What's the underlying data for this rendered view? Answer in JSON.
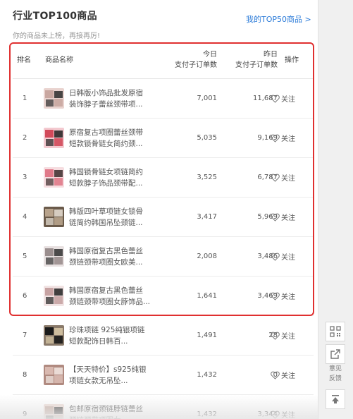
{
  "header": {
    "title": "行业TOP100商品",
    "top50_link": "我的TOP50商品 >",
    "subtitle": "你的商品未上榜，再接再厉!"
  },
  "table": {
    "col_rank": "排名",
    "col_name": "商品名称",
    "col_today_1": "今日",
    "col_today_2": "支付子订单数",
    "col_yest_1": "昨日",
    "col_yest_2": "支付子订单数",
    "col_op": "操作",
    "follow_label": "关注",
    "rows": [
      {
        "rank": "1",
        "title_1": "日韩版小饰品批发原宿",
        "title_2": "装饰脖子蕾丝颈带项...",
        "today": "7,001",
        "yesterday": "11,687"
      },
      {
        "rank": "2",
        "title_1": "原宿复古项圈蕾丝颈带",
        "title_2": "短款锁骨链女简约颈...",
        "today": "5,035",
        "yesterday": "9,169"
      },
      {
        "rank": "3",
        "title_1": "韩国锁骨链女项链简约",
        "title_2": "短款脖子饰品颈带配...",
        "today": "3,525",
        "yesterday": "6,787"
      },
      {
        "rank": "4",
        "title_1": "韩版四叶草项链女锁骨",
        "title_2": "链简约韩国吊坠颈链...",
        "today": "3,417",
        "yesterday": "5,969"
      },
      {
        "rank": "5",
        "title_1": "韩国原宿复古黑色蕾丝",
        "title_2": "颈链颈带项圈女欧美...",
        "today": "2,008",
        "yesterday": "3,486"
      },
      {
        "rank": "6",
        "title_1": "韩国原宿复古黑色蕾丝",
        "title_2": "颈链颈带项圈女脖饰品...",
        "today": "1,641",
        "yesterday": "3,469"
      },
      {
        "rank": "7",
        "title_1": "珍珠项链 925纯银项链",
        "title_2": "短款配饰日韩百...",
        "today": "1,491",
        "yesterday": "28"
      },
      {
        "rank": "8",
        "title_1": "【天天特价】s925纯银",
        "title_2": "项链女款无吊坠...",
        "today": "1,432",
        "yesterday": "0"
      },
      {
        "rank": "9",
        "title_1": "包邮原宿颈链脖链蕾丝",
        "title_2": "颈链颈带项圈女...",
        "today": "1,432",
        "yesterday": "3,344"
      }
    ]
  },
  "toolbar": {
    "feedback_1": "意见",
    "feedback_2": "反馈"
  },
  "colors": {
    "accent_link": "#2a7ad8",
    "highlight": "#e03030"
  }
}
